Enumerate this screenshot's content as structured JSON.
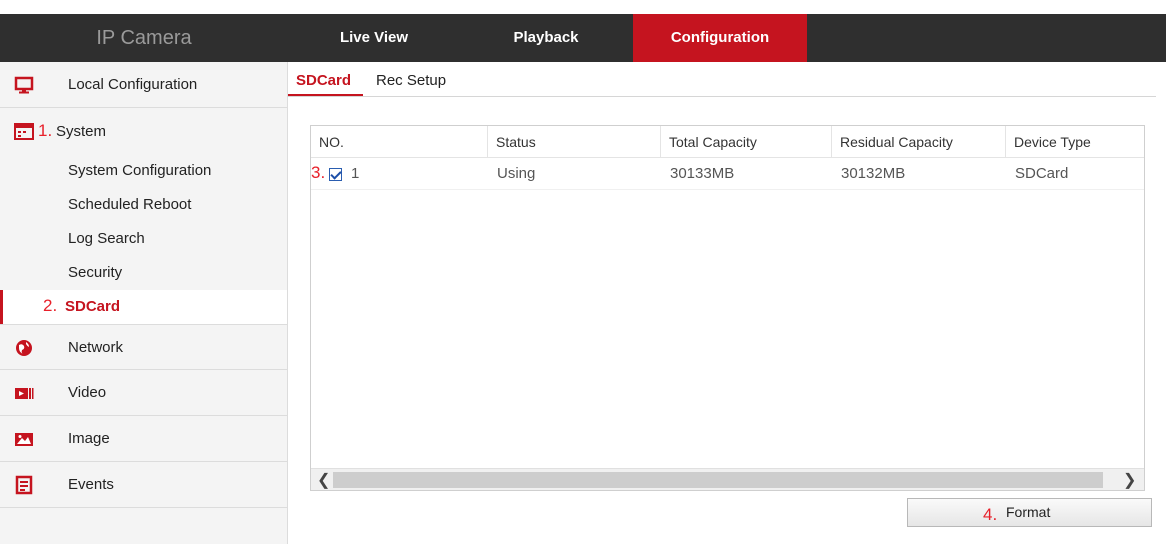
{
  "header": {
    "brand": "IP Camera",
    "nav": {
      "live_view": "Live View",
      "playback": "Playback",
      "configuration": "Configuration"
    },
    "active_color": "#c5141f"
  },
  "sidebar": {
    "local_configuration": "Local Configuration",
    "system": {
      "annotation": "1.",
      "label": "System"
    },
    "system_items": [
      "System Configuration",
      "Scheduled Reboot",
      "Log Search",
      "Security"
    ],
    "sdcard": {
      "annotation": "2.",
      "label": "SDCard"
    },
    "network": "Network",
    "video": "Video",
    "image": "Image",
    "events": "Events"
  },
  "tabs": {
    "sdcard": "SDCard",
    "rec_setup": "Rec Setup"
  },
  "table": {
    "columns": [
      "NO.",
      "Status",
      "Total Capacity",
      "Residual Capacity",
      "Device Type"
    ],
    "rows": [
      {
        "annotation": "3.",
        "checked": true,
        "no": "1",
        "status": "Using",
        "total": "30133MB",
        "residual": "30132MB",
        "type": "SDCard"
      }
    ]
  },
  "format_button": {
    "annotation": "4.",
    "label": "Format"
  }
}
